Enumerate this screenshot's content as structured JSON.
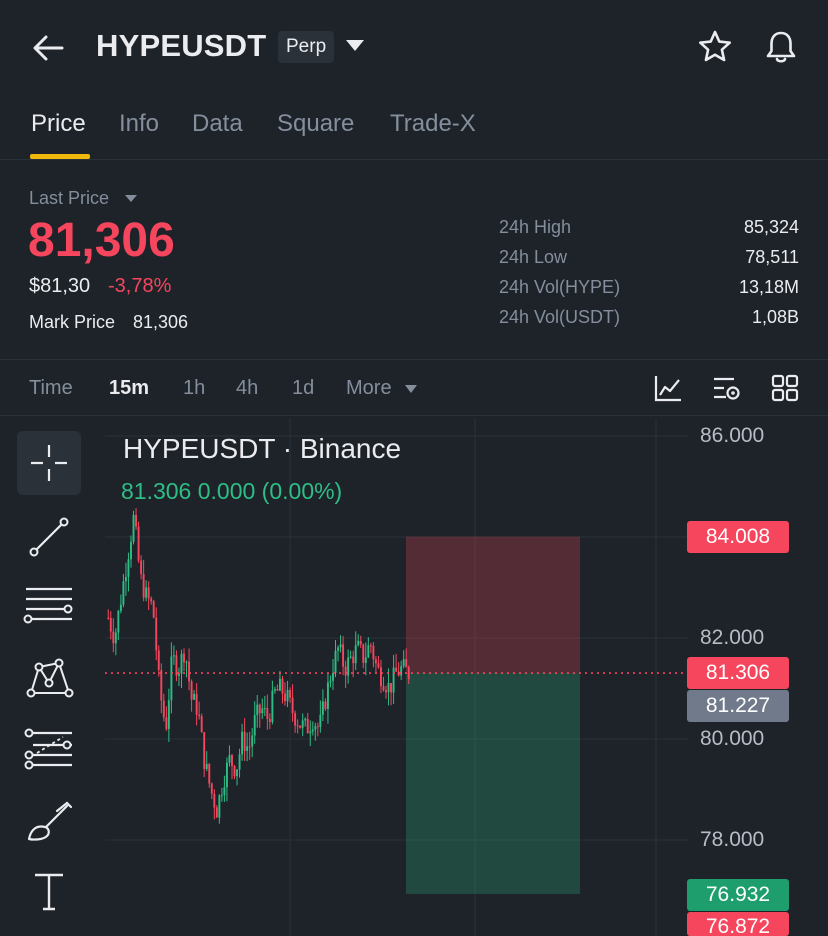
{
  "header": {
    "symbol": "HYPEUSDT",
    "contract_type": "Perp"
  },
  "tabs": [
    {
      "label": "Price",
      "active": true
    },
    {
      "label": "Info"
    },
    {
      "label": "Data"
    },
    {
      "label": "Square"
    },
    {
      "label": "Trade-X"
    }
  ],
  "stats": {
    "last_price_label": "Last Price",
    "last_price": "81,306",
    "usd_price": "$81,30",
    "change_pct": "-3,78%",
    "mark_price_label": "Mark Price",
    "mark_price": "81,306",
    "rows": [
      {
        "label": "24h High",
        "value": "85,324"
      },
      {
        "label": "24h Low",
        "value": "78,511"
      },
      {
        "label": "24h Vol(HYPE)",
        "value": "13,18M"
      },
      {
        "label": "24h Vol(USDT)",
        "value": "1,08B"
      }
    ]
  },
  "intervals": [
    {
      "label": "Time"
    },
    {
      "label": "15m",
      "active": true
    },
    {
      "label": "1h"
    },
    {
      "label": "4h"
    },
    {
      "label": "1d"
    },
    {
      "label": "More"
    }
  ],
  "chart": {
    "title": "HYPEUSDT · Binance",
    "ohlc_text": "81.306  0.000 (0.00%)",
    "y_labels": [
      "86.000",
      "82.000",
      "80.000",
      "78.000"
    ],
    "badges": {
      "take_profit": "84.008",
      "last": "81.306",
      "mark": "81.227",
      "stop": "76.932",
      "bottom": "76.872"
    },
    "colors": {
      "up": "#2ebd85",
      "down": "#f6465d",
      "accent": "#f0b90b",
      "background": "#1e2329"
    }
  },
  "chart_data": {
    "type": "candlestick",
    "interval": "15m",
    "y_labels": [
      78,
      80,
      82,
      86
    ],
    "last_price": 81.306,
    "mark_price": 81.227,
    "position": {
      "entry": 81.306,
      "take_profit": 84.008,
      "stop_loss": 76.932
    },
    "close_path": [
      82.4,
      82.0,
      82.8,
      83.6,
      84.4,
      83.2,
      82.8,
      82.6,
      81.0,
      80.2,
      81.6,
      81.4,
      81.8,
      80.8,
      80.6,
      79.6,
      79.0,
      78.6,
      79.2,
      79.6,
      79.4,
      80.0,
      79.8,
      80.4,
      80.6,
      80.4,
      80.9,
      81.0,
      80.8,
      80.5,
      80.3,
      80.2,
      80.4,
      80.2,
      80.8,
      81.4,
      81.8,
      81.4,
      81.6,
      81.8,
      81.6,
      81.9,
      81.4,
      81.2,
      81.0,
      81.3,
      81.4,
      81.3
    ]
  }
}
